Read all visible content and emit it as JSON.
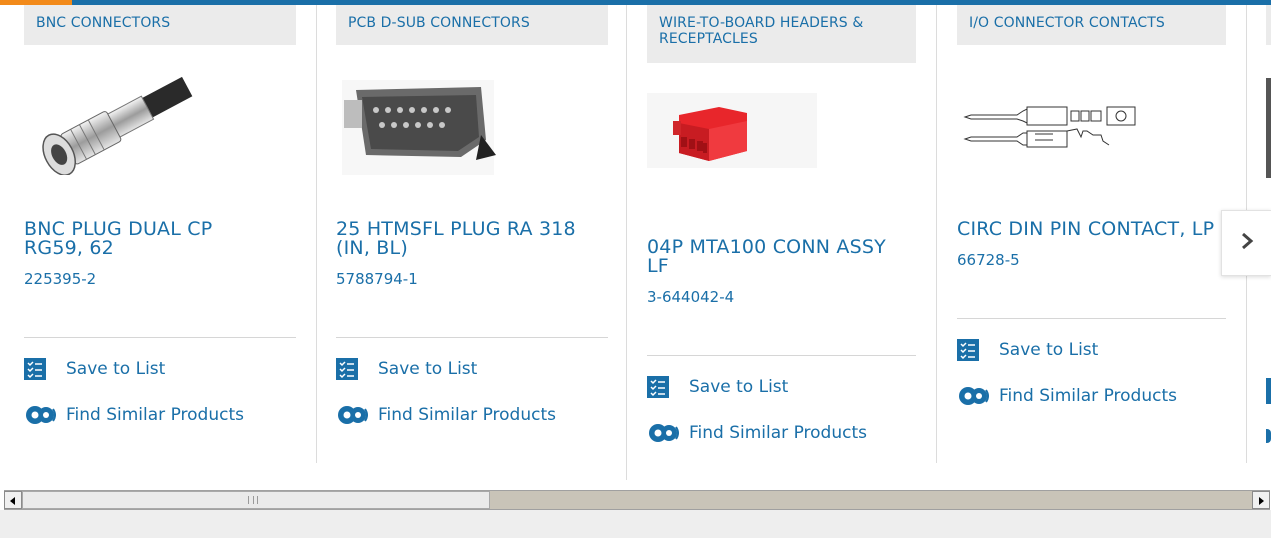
{
  "products": [
    {
      "category": "BNC CONNECTORS",
      "title": "BNC PLUG DUAL CP RG59, 62",
      "part_number": "225395-2",
      "save_label": "Save to List",
      "similar_label": "Find Similar Products",
      "image_icon": "bnc-connector-image"
    },
    {
      "category": "PCB D-SUB CONNECTORS",
      "title": "25 HTMSFL PLUG RA 318 (IN, BL)",
      "part_number": "5788794-1",
      "save_label": "Save to List",
      "similar_label": "Find Similar Products",
      "image_icon": "dsub-connector-image"
    },
    {
      "category": "WIRE-TO-BOARD HEADERS & RECEPTACLES",
      "title": "04P MTA100 CONN ASSY LF",
      "part_number": "3-644042-4",
      "save_label": "Save to List",
      "similar_label": "Find Similar Products",
      "image_icon": "red-receptacle-image"
    },
    {
      "category": "I/O CONNECTOR CONTACTS",
      "title": "CIRC DIN PIN CONTACT, LP",
      "part_number": "66728-5",
      "save_label": "Save to List",
      "similar_label": "Find Similar Products",
      "image_icon": "pin-contact-drawing"
    }
  ],
  "colors": {
    "accent": "#1a6fa8",
    "top_accent": "#f28a1a",
    "category_bg": "#ebebeb",
    "receptacle_red": "#e8262b"
  },
  "icons": {
    "save": "checklist-icon",
    "similar": "gears-icon",
    "next": "chevron-right-icon",
    "scroll_left": "triangle-left-icon",
    "scroll_right": "triangle-right-icon"
  }
}
